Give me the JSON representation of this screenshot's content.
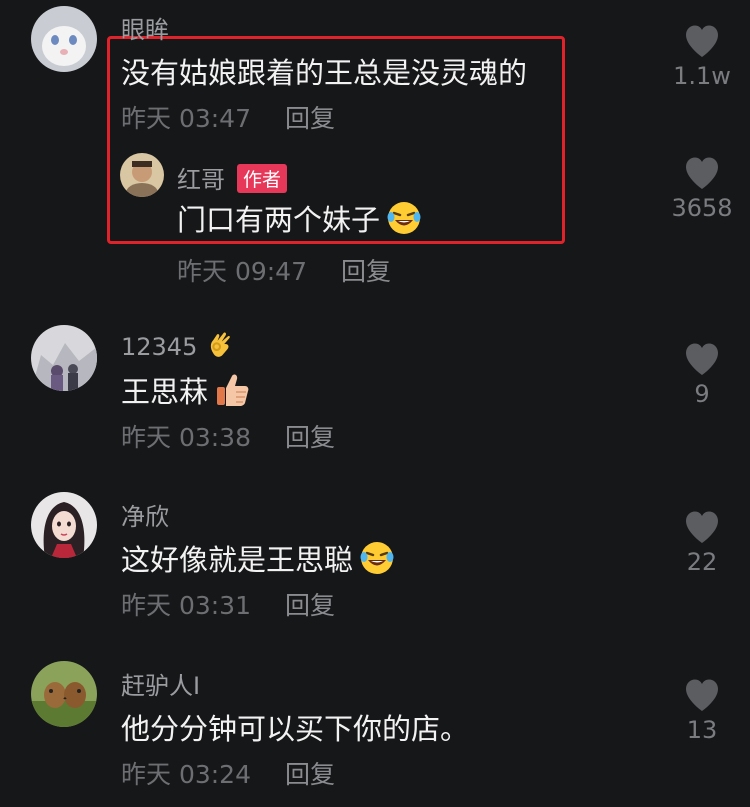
{
  "colors": {
    "background": "#161719",
    "highlight_border": "#e0232a",
    "author_badge": "#e8385a",
    "meta_text": "#6d6e72",
    "username_text": "#9b9ca0"
  },
  "comments": [
    {
      "username": "眼眸",
      "text": "没有姑娘跟着的王总是没灵魂的",
      "time": "昨天 03:47",
      "reply_label": "回复",
      "likes": "1.1w",
      "reply": {
        "username": "红哥",
        "badge": "作者",
        "text": "门口有两个妹子",
        "emoji": "laughing-crying-emoji",
        "time": "昨天 09:47",
        "reply_label": "回复",
        "likes": "3658"
      }
    },
    {
      "username": "12345",
      "username_emoji": "ok-hand-emoji",
      "text": "王思菻",
      "emoji": "thumbs-up-emoji",
      "time": "昨天 03:38",
      "reply_label": "回复",
      "likes": "9"
    },
    {
      "username": "净欣",
      "text": "这好像就是王思聪",
      "emoji": "laughing-crying-emoji",
      "time": "昨天 03:31",
      "reply_label": "回复",
      "likes": "22"
    },
    {
      "username": "赶驴人I",
      "text": "他分分钟可以买下你的店。",
      "time": "昨天 03:24",
      "reply_label": "回复",
      "likes": "13"
    }
  ]
}
